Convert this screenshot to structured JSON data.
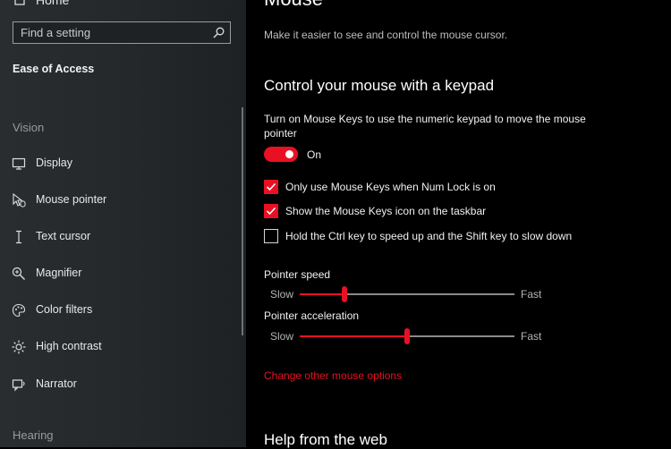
{
  "sidebar": {
    "home_label": "Home",
    "search_placeholder": "Find a setting",
    "section_title": "Ease of Access",
    "group_vision": "Vision",
    "items": [
      {
        "label": "Display",
        "icon": "monitor-icon"
      },
      {
        "label": "Mouse pointer",
        "icon": "mouse-pointer-icon"
      },
      {
        "label": "Text cursor",
        "icon": "text-cursor-icon"
      },
      {
        "label": "Magnifier",
        "icon": "magnifier-icon"
      },
      {
        "label": "Color filters",
        "icon": "color-filters-icon"
      },
      {
        "label": "High contrast",
        "icon": "high-contrast-icon"
      },
      {
        "label": "Narrator",
        "icon": "narrator-icon"
      }
    ],
    "group_hearing": "Hearing"
  },
  "main": {
    "page_title": "Mouse",
    "description": "Make it easier to see and control the mouse cursor.",
    "keypad_heading": "Control your mouse with a keypad",
    "mouse_keys_text": "Turn on Mouse Keys to use the numeric keypad to move the mouse pointer",
    "toggle": {
      "state_label": "On",
      "on": true
    },
    "checkboxes": [
      {
        "label": "Only use Mouse Keys when Num Lock is on",
        "checked": true
      },
      {
        "label": "Show the Mouse Keys icon on the taskbar",
        "checked": true
      },
      {
        "label": "Hold the Ctrl key to speed up and the Shift key to slow down",
        "checked": false
      }
    ],
    "sliders": [
      {
        "title": "Pointer speed",
        "min_label": "Slow",
        "max_label": "Fast",
        "value_fraction": 0.21
      },
      {
        "title": "Pointer acceleration",
        "min_label": "Slow",
        "max_label": "Fast",
        "value_fraction": 0.5
      }
    ],
    "link_text": "Change other mouse options",
    "help_heading": "Help from the web"
  },
  "colors": {
    "accent": "#e81123",
    "background": "#000000",
    "sidebar": "#26292c"
  }
}
